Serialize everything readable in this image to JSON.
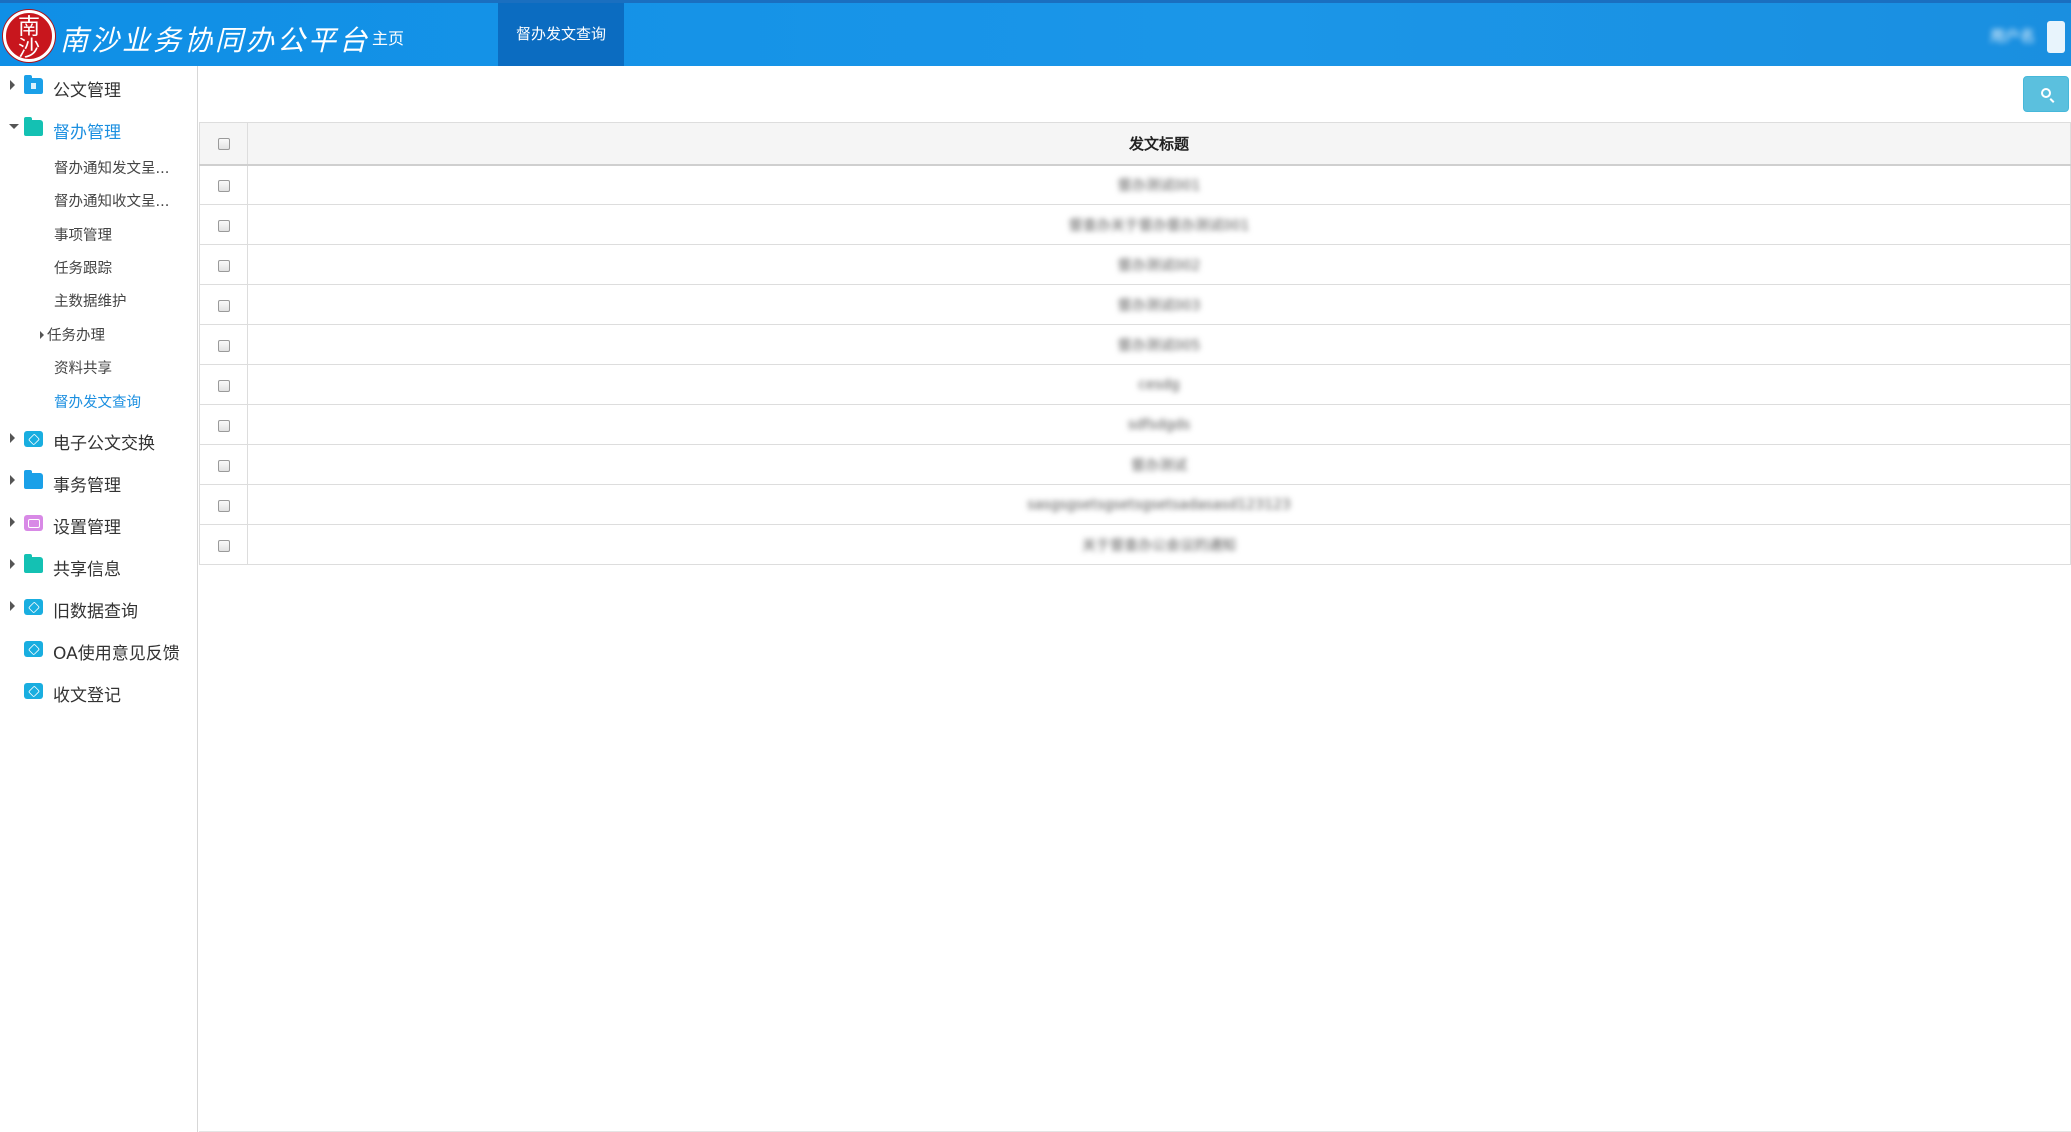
{
  "header": {
    "logo_chars": [
      "南",
      "沙"
    ],
    "app_title": "南沙业务协同办公平台",
    "nav_home": "主页",
    "active_tab": "督办发文查询",
    "user_name": "用户名"
  },
  "sidebar": {
    "items": [
      {
        "label": "公文管理",
        "icon": "folder-icon",
        "expanded": false
      },
      {
        "label": "督办管理",
        "icon": "folder-icon",
        "expanded": true
      },
      {
        "label": "电子公文交换",
        "icon": "cube-icon",
        "expanded": false
      },
      {
        "label": "事务管理",
        "icon": "folder-icon",
        "expanded": false
      },
      {
        "label": "设置管理",
        "icon": "settings-icon",
        "expanded": false
      },
      {
        "label": "共享信息",
        "icon": "folder-icon",
        "expanded": false
      },
      {
        "label": "旧数据查询",
        "icon": "cube-icon",
        "expanded": false
      },
      {
        "label": "OA使用意见反馈",
        "icon": "cube-icon"
      },
      {
        "label": "收文登记",
        "icon": "cube-icon"
      }
    ],
    "submenu": [
      {
        "label": "督办通知发文呈..."
      },
      {
        "label": "督办通知收文呈..."
      },
      {
        "label": "事项管理"
      },
      {
        "label": "任务跟踪"
      },
      {
        "label": "主数据维护"
      },
      {
        "label": "任务办理"
      },
      {
        "label": "资料共享"
      },
      {
        "label": "督办发文查询"
      }
    ]
  },
  "table": {
    "header": "发文标题",
    "rows": [
      "督办测试001",
      "督查办关于督办督办测试001",
      "督办测试002",
      "督办测试003",
      "督办测试005",
      "cesdg",
      "sdfsdgds",
      "督办测试",
      "sasgsgsetsgsetsgsetsadasasd123123",
      "关于督查办公会议的通知"
    ]
  },
  "colors": {
    "header_bg": "#1b96e8",
    "active_tab_bg": "#0b6cc1",
    "accent": "#1b8fe0",
    "search_button": "#5bc0de"
  }
}
